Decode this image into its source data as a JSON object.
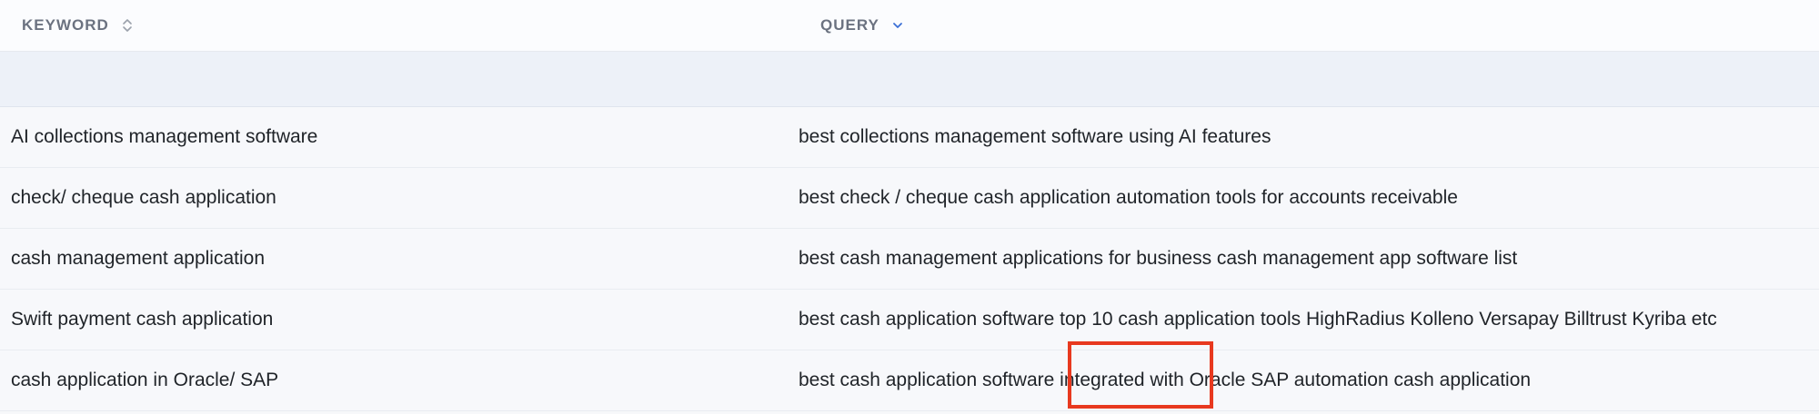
{
  "header": {
    "keyword_label": "KEYWORD",
    "query_label": "QUERY"
  },
  "icons": {
    "keyword_sort": "sort-updown-icon",
    "query_sort": "chevron-down-icon"
  },
  "colors": {
    "accent": "#3b6fd6",
    "highlight": "#e8391f"
  },
  "rows": [
    {
      "keyword": "AI collections management software",
      "query": "best collections management software using AI features"
    },
    {
      "keyword": "check/ cheque cash application",
      "query": "best check / cheque cash application automation tools for accounts receivable"
    },
    {
      "keyword": "cash management application",
      "query": "best cash management applications for business cash management app software list"
    },
    {
      "keyword": "Swift payment cash application",
      "query": "best cash application software top 10 cash application tools HighRadius Kolleno Versapay Billtrust Kyriba etc"
    },
    {
      "keyword": "cash application in Oracle/ SAP",
      "query": "best cash application software integrated with Oracle SAP automation cash application"
    }
  ]
}
